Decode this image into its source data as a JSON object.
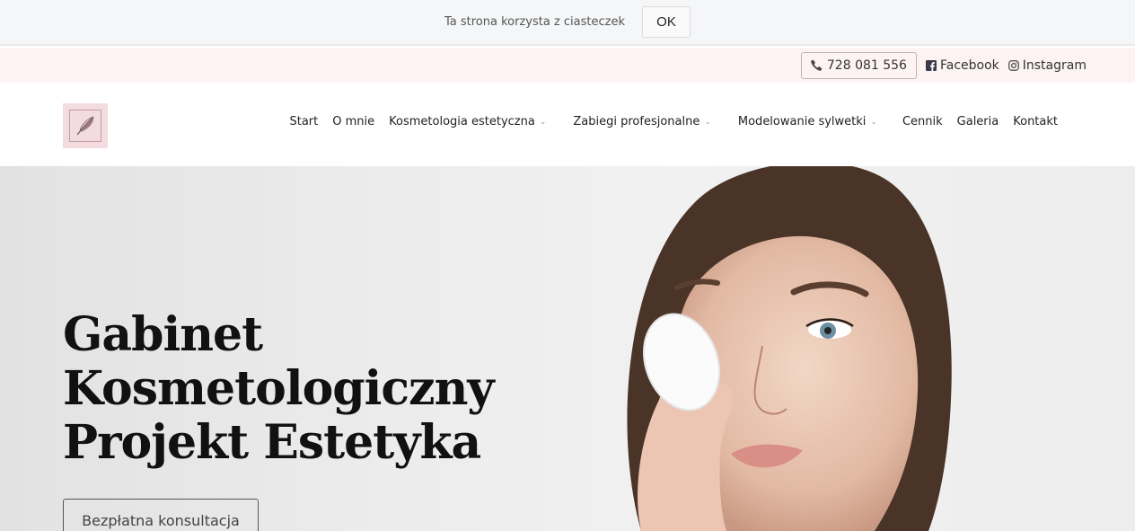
{
  "cookie": {
    "text": "Ta strona korzysta z ciasteczek",
    "ok_label": "OK"
  },
  "topbar": {
    "phone": "728 081 556",
    "facebook": "Facebook",
    "instagram": "Instagram",
    "icons": [
      "phone-icon",
      "facebook-icon",
      "instagram-icon"
    ]
  },
  "nav": {
    "items": [
      {
        "label": "Start"
      },
      {
        "label": "O mnie"
      },
      {
        "label": "Kosmetologia estetyczna"
      },
      {
        "label": "Zabiegi profesjonalne"
      },
      {
        "label": "Modelowanie sylwetki"
      },
      {
        "label": "Cennik"
      },
      {
        "label": "Galeria"
      },
      {
        "label": "Kontakt"
      }
    ]
  },
  "hero": {
    "title_line1": "Gabinet",
    "title_line2": "Kosmetologiczny",
    "title_line3": "Projekt Estetyka",
    "button_label": "Bezpłatna konsultacja"
  },
  "colors": {
    "topbar_bg": "#fdf3f3",
    "logo_bg": "#f3dcdf",
    "cookie_bg": "#f5f6f8"
  }
}
